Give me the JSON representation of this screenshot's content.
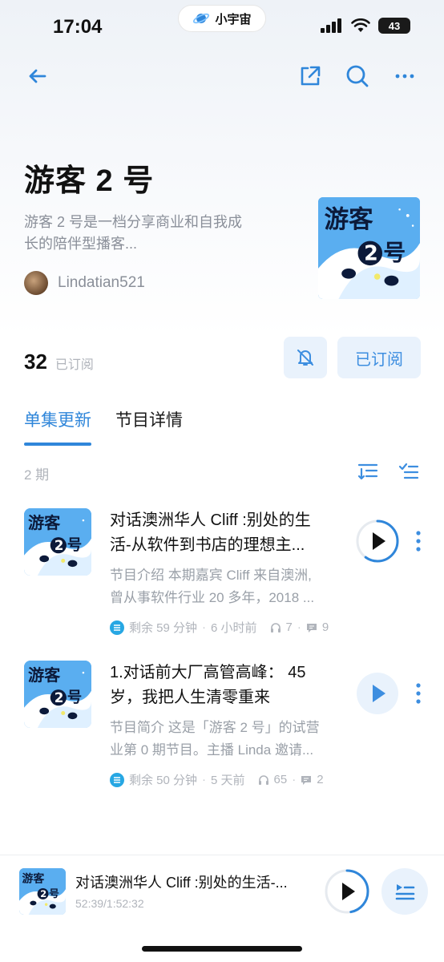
{
  "status_bar": {
    "time": "17:04",
    "pill_label": "小宇宙",
    "battery": "43"
  },
  "nav": {
    "back_icon": "back-arrow-icon",
    "share_icon": "share-icon",
    "search_icon": "search-icon",
    "more_icon": "more-icon"
  },
  "podcast": {
    "title": "游客 2 号",
    "description_line1": "游客 2 号是一档分享商业和自我成",
    "description_line2": "长的陪伴型播客...",
    "author": "Lindatian521",
    "cover_text_top": "游客",
    "cover_text_num": "2",
    "cover_text_suffix": "号"
  },
  "subscription": {
    "count": "32",
    "count_label": "已订阅",
    "button_label": "已订阅"
  },
  "tabs": [
    {
      "label": "单集更新",
      "active": true
    },
    {
      "label": "节目详情",
      "active": false
    }
  ],
  "episode_count": "2 期",
  "episodes": [
    {
      "title_line1": "对话澳洲华人 Cliff :别处的生",
      "title_line2": "活-从软件到书店的理想主...",
      "desc_line1": "节目介绍 本期嘉宾 Cliff 来自澳洲,",
      "desc_line2": "曾从事软件行业 20 多年，2018 ...",
      "remaining": "剩余 59 分钟",
      "time_ago": "6 小时前",
      "plays": "7",
      "comments": "9",
      "progress": 0.6
    },
    {
      "title_line1": "1.对话前大厂高管高峰： 45",
      "title_line2": "岁，我把人生清零重来",
      "desc_line1": "节目简介 这是「游客 2 号」的试营",
      "desc_line2": "业第 0 期节目。主播 Linda 邀请...",
      "remaining": "剩余 50 分钟",
      "time_ago": "5 天前",
      "plays": "65",
      "comments": "2",
      "progress": 0
    }
  ],
  "mini_player": {
    "title": "对话澳洲华人 Cliff :别处的生活-...",
    "time": "52:39/1:52:32",
    "progress": 0.47
  },
  "colors": {
    "accent": "#2f86da",
    "light_accent": "#e9f2fc",
    "cover_blue": "#5aaef0"
  }
}
